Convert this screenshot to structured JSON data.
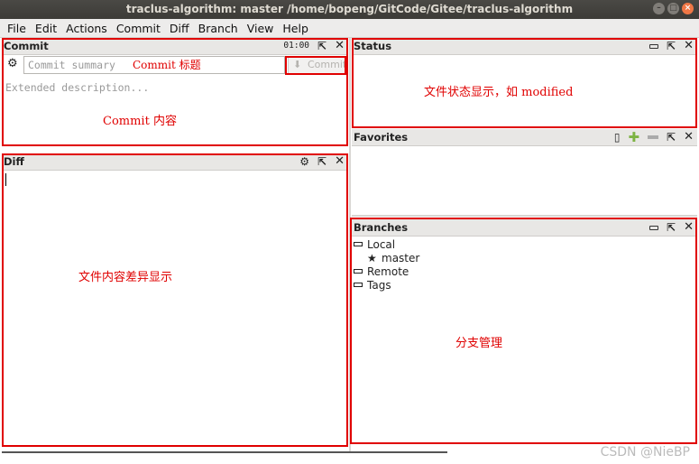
{
  "window": {
    "title": "traclus-algorithm: master /home/bopeng/GitCode/Gitee/traclus-algorithm",
    "controls": [
      "minimize",
      "maximize",
      "close"
    ]
  },
  "menu": [
    "File",
    "Edit",
    "Actions",
    "Commit",
    "Diff",
    "Branch",
    "View",
    "Help"
  ],
  "commit_panel": {
    "title": "Commit",
    "timer": "01:00",
    "summary_placeholder": "Commit summary",
    "commit_button": "Commit",
    "description_placeholder": "Extended description...",
    "annotation_summary": "Commit 标题",
    "annotation_desc": "Commit 内容"
  },
  "diff_panel": {
    "title": "Diff",
    "annotation": "文件内容差异显示"
  },
  "status_panel": {
    "title": "Status",
    "annotation": "文件状态显示，如 modified"
  },
  "favorites_panel": {
    "title": "Favorites"
  },
  "branches_panel": {
    "title": "Branches",
    "tree": {
      "local": "Local",
      "current_branch": "master",
      "remote": "Remote",
      "tags": "Tags"
    },
    "annotation": "分支管理"
  },
  "watermark": "CSDN @NieBP",
  "colors": {
    "annotation_red": "#e00000",
    "titlebar": "#3c3b37",
    "plus_green": "#7cb342"
  },
  "icons": [
    "gear-icon",
    "download-icon",
    "detach-icon",
    "close-icon",
    "minimize-icon",
    "star-icon",
    "clipboard-icon",
    "plus-icon",
    "minus-icon"
  ]
}
